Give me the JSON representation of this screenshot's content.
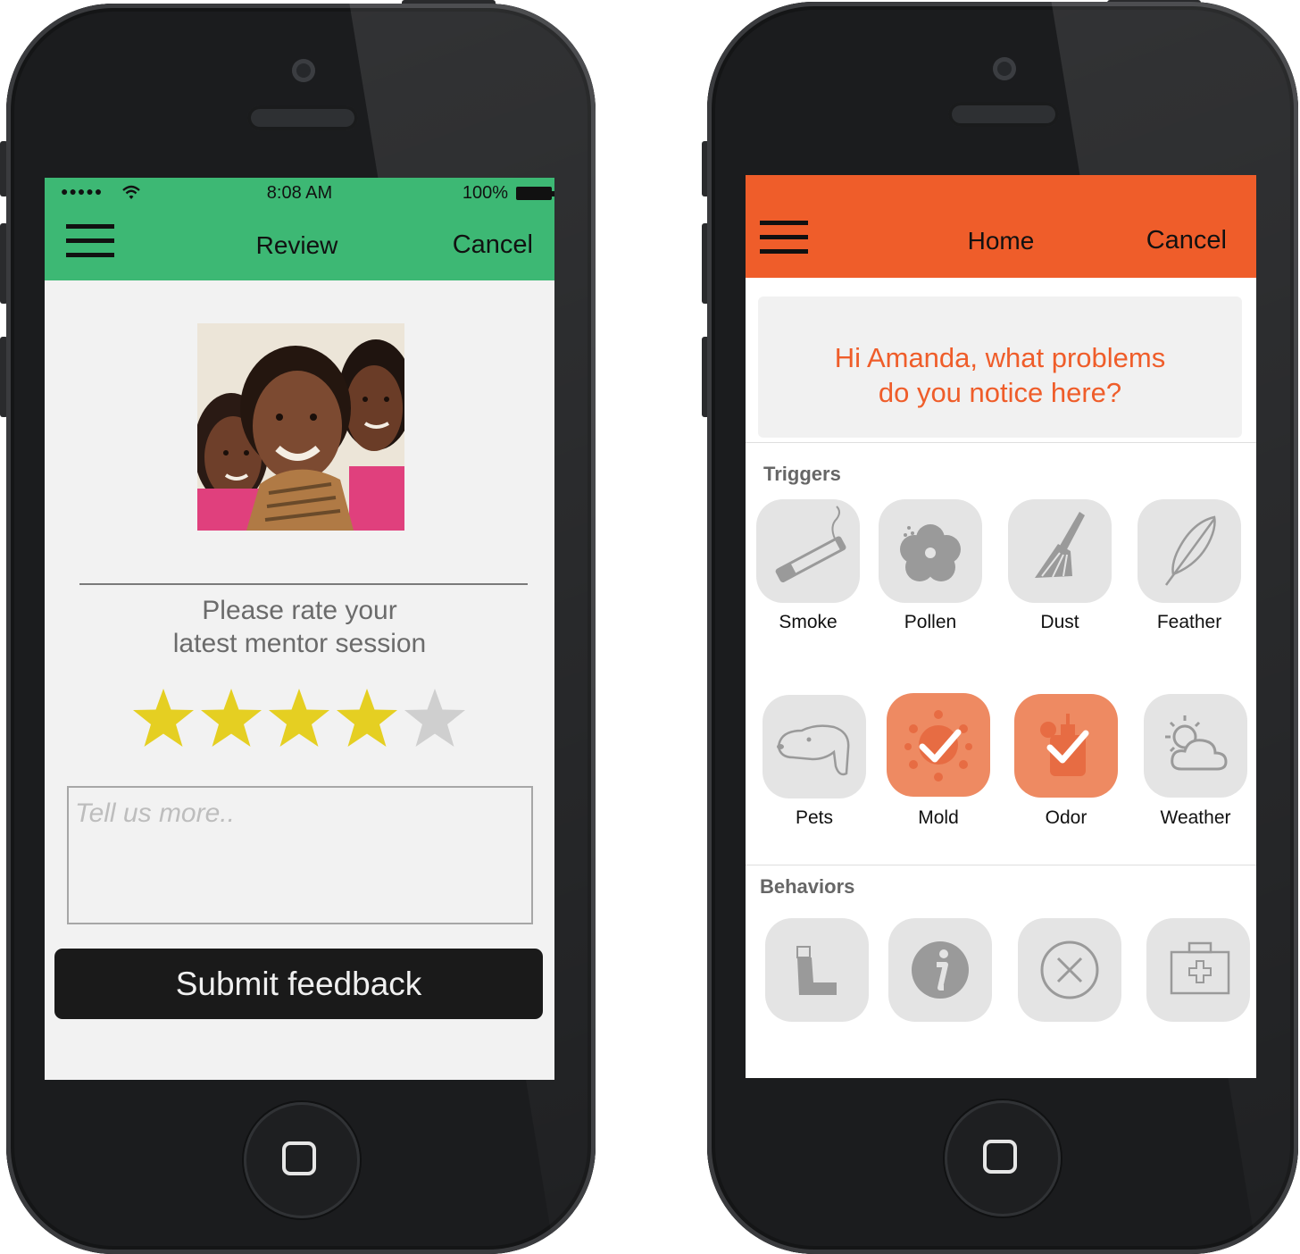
{
  "left_screen": {
    "status": {
      "signal": "●●●●●",
      "time": "8:08 AM",
      "battery": "100%"
    },
    "nav": {
      "title": "Review",
      "cancel": "Cancel"
    },
    "rating_prompt_line1": "Please rate your",
    "rating_prompt_line2": "latest mentor session",
    "rating": {
      "value": 4,
      "max": 5
    },
    "feedback_placeholder": "Tell us more..",
    "submit_label": "Submit feedback",
    "colors": {
      "nav": "#3db874",
      "star_on": "#e5cf22",
      "star_off": "#cfcfcf"
    }
  },
  "right_screen": {
    "nav": {
      "title": "Home",
      "cancel": "Cancel"
    },
    "greeting_line1": "Hi Amanda, what problems",
    "greeting_line2": "do you notice here?",
    "triggers_label": "Triggers",
    "triggers": [
      {
        "label": "Smoke",
        "icon": "cigarette-icon",
        "selected": false
      },
      {
        "label": "Pollen",
        "icon": "flower-icon",
        "selected": false
      },
      {
        "label": "Dust",
        "icon": "broom-icon",
        "selected": false
      },
      {
        "label": "Feather",
        "icon": "feather-icon",
        "selected": false
      },
      {
        "label": "Pets",
        "icon": "dog-icon",
        "selected": false
      },
      {
        "label": "Mold",
        "icon": "mold-icon",
        "selected": true
      },
      {
        "label": "Odor",
        "icon": "perfume-icon",
        "selected": true
      },
      {
        "label": "Weather",
        "icon": "weather-icon",
        "selected": false
      }
    ],
    "behaviors_label": "Behaviors",
    "behaviors": [
      {
        "icon": "inhaler-icon"
      },
      {
        "icon": "info-icon"
      },
      {
        "icon": "cancel-circle-icon"
      },
      {
        "icon": "first-aid-kit-icon"
      }
    ],
    "colors": {
      "nav": "#ef5d2a",
      "selected_tile": "#ee8a62"
    }
  }
}
